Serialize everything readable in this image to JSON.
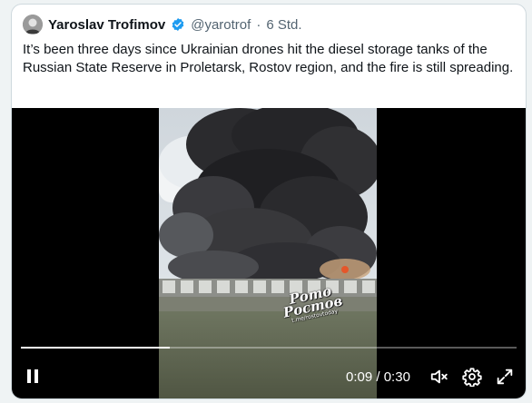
{
  "tweet": {
    "author_name": "Yaroslav Trofimov",
    "handle": "@yarotrof",
    "separator": "·",
    "time": "6 Std.",
    "text": "It’s been three days since Ukrainian drones hit the diesel storage tanks of the Russian State Reserve in Proletarsk, Rostov region, and the fire is still spreading."
  },
  "video": {
    "current_time": "0:09",
    "time_separator": "/",
    "duration": "0:30",
    "progress_fraction": 0.3,
    "watermark_title": "Рото Ростов",
    "watermark_sub": "t.me/rostovtoday",
    "controls": {
      "play_state_icon": "pause-icon",
      "mute_icon": "volume-muted-icon",
      "settings_icon": "gear-icon",
      "fullscreen_icon": "fullscreen-expand-icon"
    }
  },
  "colors": {
    "verified_badge": "#1d9bf0",
    "secondary_text": "#536471",
    "video_background": "#000000"
  }
}
